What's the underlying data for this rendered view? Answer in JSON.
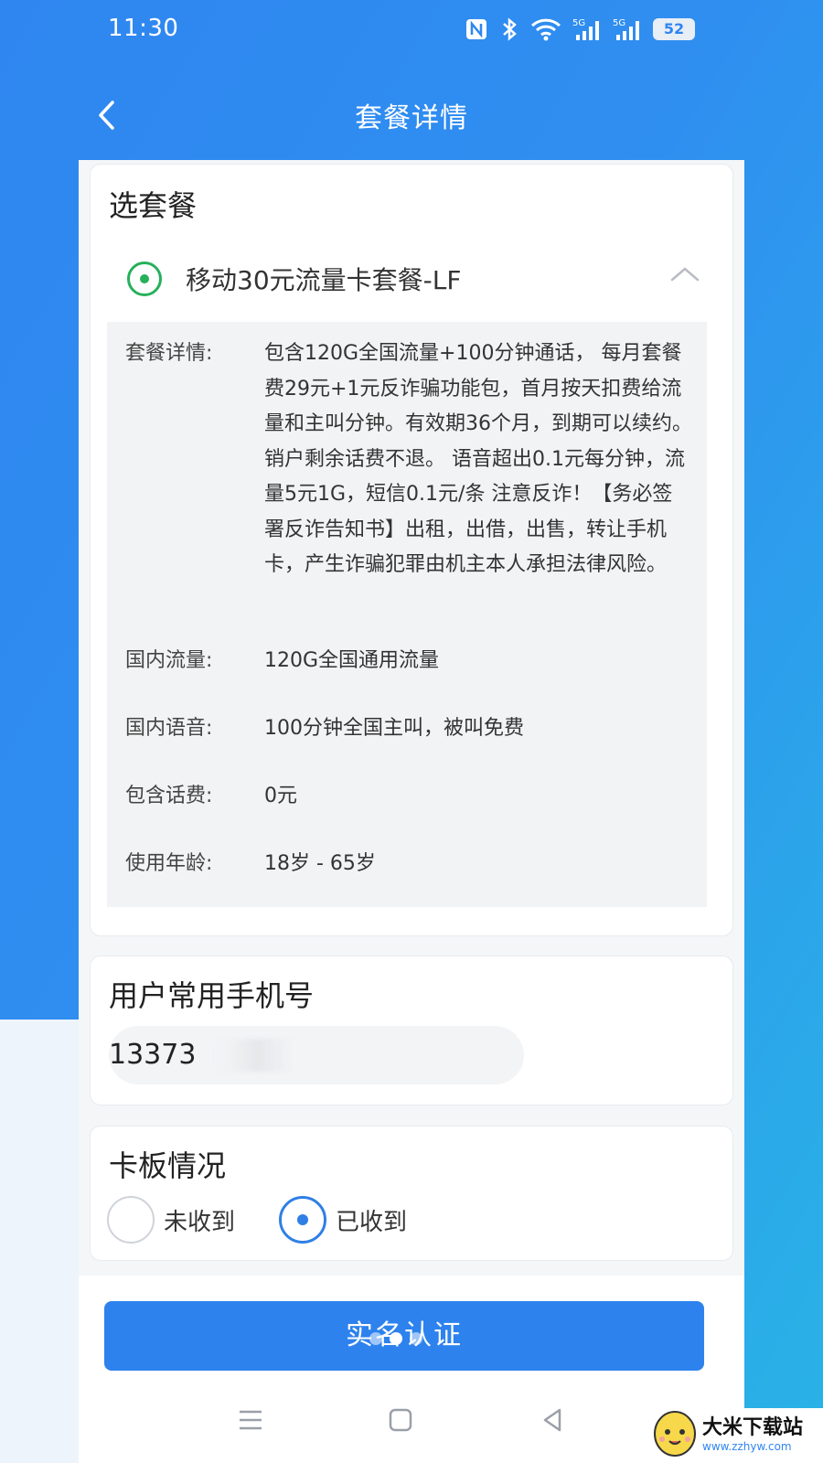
{
  "status_bar": {
    "time": "11:30",
    "battery": "52",
    "icons": [
      "nfc-icon",
      "bluetooth-icon",
      "wifi-icon",
      "signal-5g-icon",
      "signal-5g-icon",
      "battery-icon"
    ]
  },
  "header": {
    "title": "套餐详情",
    "back_icon": "chevron-left-icon"
  },
  "plan_card": {
    "title": "选套餐",
    "plan_name": "移动30元流量卡套餐-LF",
    "details": [
      {
        "label": "套餐详情:",
        "value": "包含120G全国流量+100分钟通话， 每月套餐费29元+1元反诈骗功能包，首月按天扣费给流量和主叫分钟。有效期36个月，到期可以续约。销户剩余话费不退。 语音超出0.1元每分钟，流量5元1G，短信0.1元/条 注意反诈！【务必签署反诈告知书】出租，出借，出售，转让手机卡，产生诈骗犯罪由机主本人承担法律风险。"
      },
      {
        "label": "国内流量:",
        "value": "120G全国通用流量"
      },
      {
        "label": "国内语音:",
        "value": "100分钟全国主叫，被叫免费"
      },
      {
        "label": "包含话费:",
        "value": "0元"
      },
      {
        "label": "使用年龄:",
        "value": "18岁 - 65岁"
      }
    ]
  },
  "phone_card": {
    "title": "用户常用手机号",
    "phone_value": "13373"
  },
  "sim_card": {
    "title": "卡板情况",
    "options": [
      {
        "label": "未收到",
        "selected": false
      },
      {
        "label": "已收到",
        "selected": true
      }
    ]
  },
  "submit": {
    "label": "实名认证"
  },
  "watermark": {
    "title": "大米下载站",
    "url": "www.zzhyw.com"
  },
  "colors": {
    "brand_blue": "#2d82ee",
    "selected_green": "#26b05a"
  }
}
